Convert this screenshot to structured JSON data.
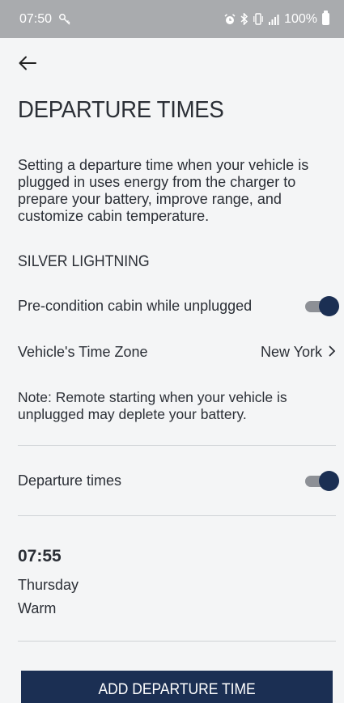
{
  "status_bar": {
    "time": "07:50",
    "battery_percent": "100%",
    "icons": [
      "key-icon",
      "alarm-icon",
      "bluetooth-icon",
      "vibrate-icon",
      "signal-icon",
      "battery-icon"
    ]
  },
  "header": {
    "back_icon": "arrow-left-icon",
    "title": "DEPARTURE TIMES"
  },
  "description": "Setting a departure time when your vehicle is plugged in uses energy from the charger to prepare your battery, improve range, and customize cabin temperature.",
  "vehicle_name": "SILVER LIGHTNING",
  "settings": {
    "precondition_label": "Pre-condition cabin while unplugged",
    "precondition_on": true,
    "timezone_label": "Vehicle's Time Zone",
    "timezone_value": "New York",
    "note": "Note: Remote starting when your vehicle is unplugged may deplete your battery.",
    "departure_label": "Departure times",
    "departure_on": true
  },
  "departure": {
    "time": "07:55",
    "day": "Thursday",
    "mode": "Warm"
  },
  "add_button_label": "ADD DEPARTURE TIME",
  "colors": {
    "primary": "#1b2f53",
    "status_bar": "#a9abae",
    "background": "#f4f5f6",
    "toggle_track": "#8d9096"
  }
}
